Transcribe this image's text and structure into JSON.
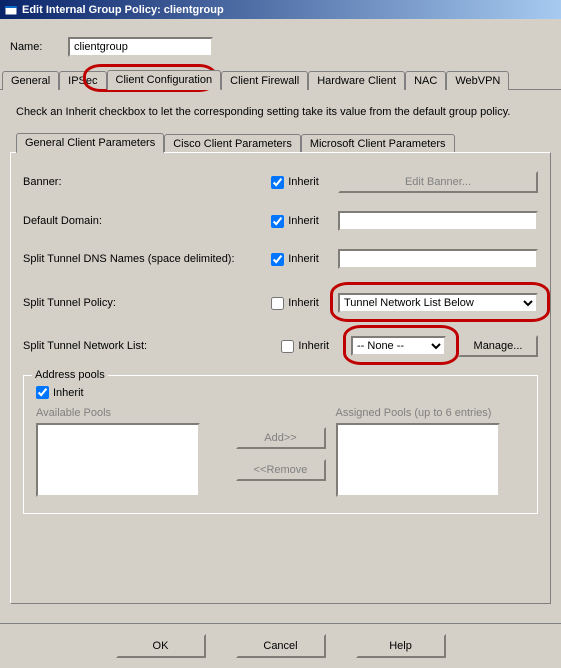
{
  "window": {
    "title": "Edit Internal Group Policy: clientgroup"
  },
  "name": {
    "label": "Name:",
    "value": "clientgroup"
  },
  "main_tabs": {
    "general": "General",
    "ipsec": "IPSec",
    "client_config": "Client Configuration",
    "client_firewall": "Client Firewall",
    "hardware_client": "Hardware Client",
    "nac": "NAC",
    "webvpn": "WebVPN"
  },
  "info_text": "Check an Inherit checkbox to let the corresponding setting take its value from the default group policy.",
  "sub_tabs": {
    "general": "General Client Parameters",
    "cisco": "Cisco Client Parameters",
    "microsoft": "Microsoft Client Parameters"
  },
  "inherit_label": "Inherit",
  "rows": {
    "banner": {
      "label": "Banner:",
      "button": "Edit Banner..."
    },
    "default_domain": {
      "label": "Default Domain:"
    },
    "split_dns": {
      "label": "Split Tunnel DNS Names (space delimited):"
    },
    "split_policy": {
      "label": "Split Tunnel Policy:",
      "value": "Tunnel Network List Below"
    },
    "split_list": {
      "label": "Split Tunnel Network List:",
      "value": "-- None --",
      "manage": "Manage..."
    }
  },
  "address_pools": {
    "title": "Address pools",
    "inherit": "Inherit",
    "available": "Available Pools",
    "assigned": "Assigned Pools (up to 6 entries)",
    "add": "Add>>",
    "remove": "<<Remove"
  },
  "buttons": {
    "ok": "OK",
    "cancel": "Cancel",
    "help": "Help"
  }
}
